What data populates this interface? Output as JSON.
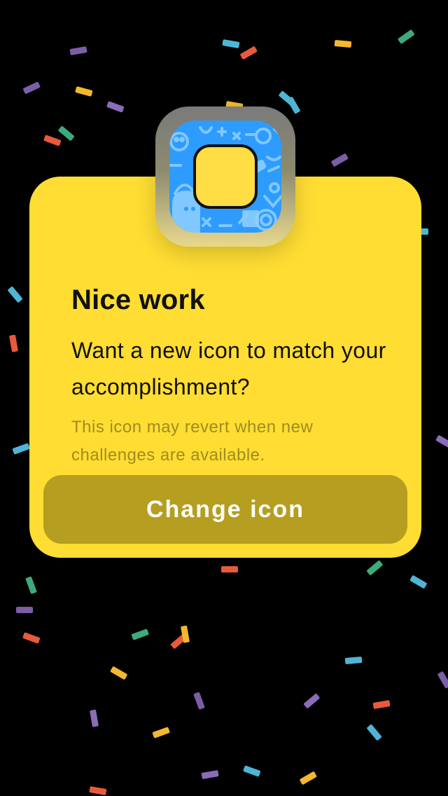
{
  "dialog": {
    "title": "Nice work",
    "message": "Want a new icon to match your accomplishment?",
    "note": "This icon may revert when new challenges are available.",
    "button_label": "Change icon"
  },
  "icon": {
    "name": "app-icon",
    "background_color": "#2E9BFF",
    "badge_color": "#FFDD44"
  },
  "colors": {
    "card": "#FFDD33",
    "button": "#B59E20",
    "note_text": "#A08C1E",
    "background": "#000000"
  },
  "confetti_palette": [
    "#7B5EA7",
    "#F2B82E",
    "#4FB5D6",
    "#E85A3C",
    "#3DAA7C",
    "#8A6CB8"
  ]
}
